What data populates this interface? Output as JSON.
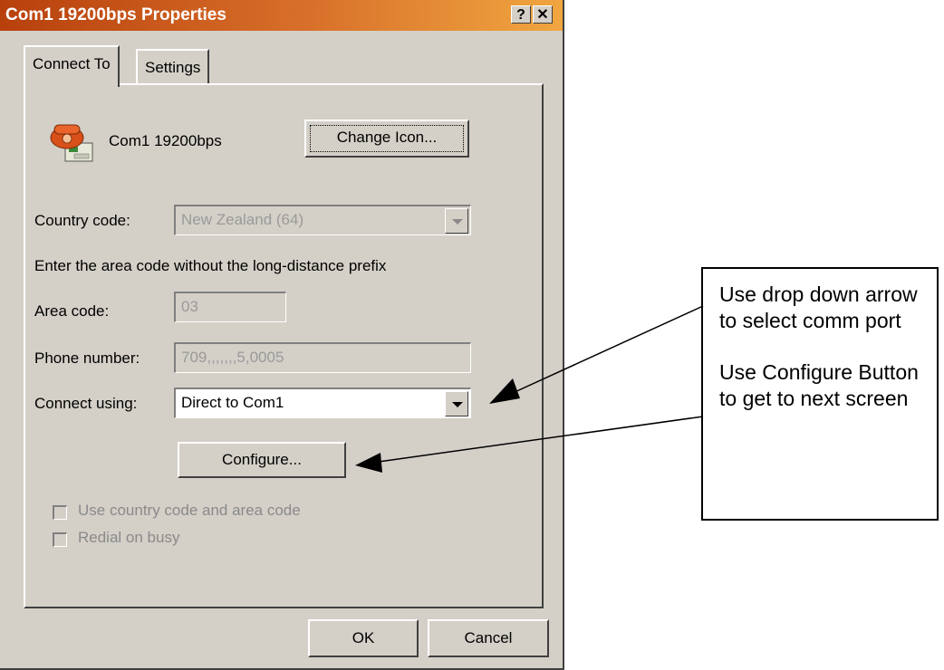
{
  "window": {
    "title": "Com1 19200bps Properties",
    "help_button": "?",
    "close_button": "✕"
  },
  "tabs": [
    {
      "label": "Connect To",
      "active": true
    },
    {
      "label": "Settings",
      "active": false
    }
  ],
  "connection": {
    "name": "Com1 19200bps",
    "icon": "phone-icon",
    "change_icon_label": "Change Icon..."
  },
  "country_code": {
    "label": "Country code:",
    "value": "New Zealand (64)"
  },
  "area_hint": "Enter the area code without the long-distance prefix",
  "area_code": {
    "label": "Area code:",
    "value": "03"
  },
  "phone_number": {
    "label": "Phone number:",
    "value": "709,,,,,,,5,0005"
  },
  "connect_using": {
    "label": "Connect using:",
    "value": "Direct to Com1"
  },
  "configure_label": "Configure...",
  "checkboxes": [
    {
      "label": "Use country code and area code",
      "checked": false
    },
    {
      "label": "Redial on busy",
      "checked": false
    }
  ],
  "footer": {
    "ok_label": "OK",
    "cancel_label": "Cancel"
  },
  "callout": {
    "note1": "Use drop down arrow to select comm port",
    "note2": "Use Configure Button to get to next screen"
  }
}
